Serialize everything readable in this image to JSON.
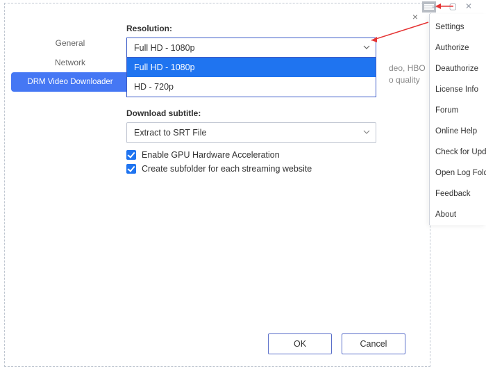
{
  "dialog": {
    "close": "×",
    "sidebar": {
      "items": [
        {
          "label": "General"
        },
        {
          "label": "Network"
        },
        {
          "label": "DRM Video Downloader"
        }
      ]
    },
    "resolution": {
      "label": "Resolution:",
      "selected": "Full HD - 1080p",
      "options": [
        "Full HD - 1080p",
        "HD - 720p"
      ]
    },
    "subtitle": {
      "label": "Download subtitle:",
      "selected": "Extract to SRT File"
    },
    "checks": {
      "gpu": "Enable GPU Hardware Acceleration",
      "subfolder": "Create subfolder for each streaming website"
    },
    "buttons": {
      "ok": "OK",
      "cancel": "Cancel"
    }
  },
  "bg": {
    "line1": "deo, HBO",
    "line2": "o quality"
  },
  "winctl": {
    "min": "—",
    "max": "▢",
    "close": "✕"
  },
  "menu": {
    "items": [
      "Settings",
      "Authorize",
      "Deauthorize",
      "License Info",
      "Forum",
      "Online Help",
      "Check for Updates",
      "Open Log Folder",
      "Feedback",
      "About"
    ]
  }
}
